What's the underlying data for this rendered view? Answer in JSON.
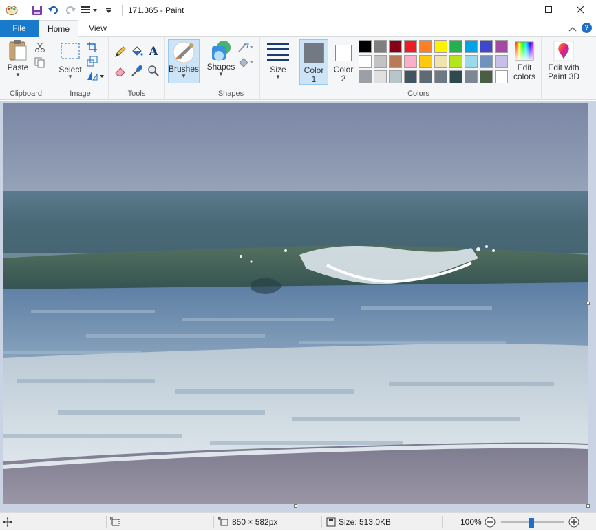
{
  "window": {
    "title": "171.365 - Paint"
  },
  "tabs": {
    "file": "File",
    "home": "Home",
    "view": "View"
  },
  "groups": {
    "clipboard": "Clipboard",
    "image": "Image",
    "tools": "Tools",
    "shapes": "Shapes",
    "colors": "Colors"
  },
  "buttons": {
    "paste": "Paste",
    "select": "Select",
    "brushes": "Brushes",
    "shapes": "Shapes",
    "size": "Size",
    "color1_line1": "Color",
    "color1_line2": "1",
    "color2_line1": "Color",
    "color2_line2": "2",
    "edit_colors_line1": "Edit",
    "edit_colors_line2": "colors",
    "paint3d_line1": "Edit with",
    "paint3d_line2": "Paint 3D"
  },
  "colors": {
    "color1": "#737983",
    "color2": "#ffffff",
    "palette_row1": [
      "#000000",
      "#7f7f7f",
      "#880015",
      "#ed1c24",
      "#ff7f27",
      "#fff200",
      "#22b14c",
      "#00a2e8",
      "#3f48cc",
      "#a349a4"
    ],
    "palette_row2": [
      "#ffffff",
      "#c3c3c3",
      "#b97a57",
      "#ffaec9",
      "#ffc90e",
      "#efe4b0",
      "#b5e61d",
      "#99d9ea",
      "#7092be",
      "#c8bfe7"
    ],
    "palette_row3": [
      "#9aa0a6",
      "#e0e0e0",
      "#b9c6c9",
      "#3f5560",
      "#5e6b74",
      "#6d7a86",
      "#2e4a4f",
      "#7c8796",
      "#4a5e45",
      "#ffffff"
    ]
  },
  "status": {
    "dimensions": "850 × 582px",
    "size": "Size: 513.0KB",
    "zoom": "100%"
  },
  "icons": {
    "app": "paint-app-icon",
    "save": "save-icon",
    "undo": "undo-icon",
    "redo": "redo-icon"
  }
}
